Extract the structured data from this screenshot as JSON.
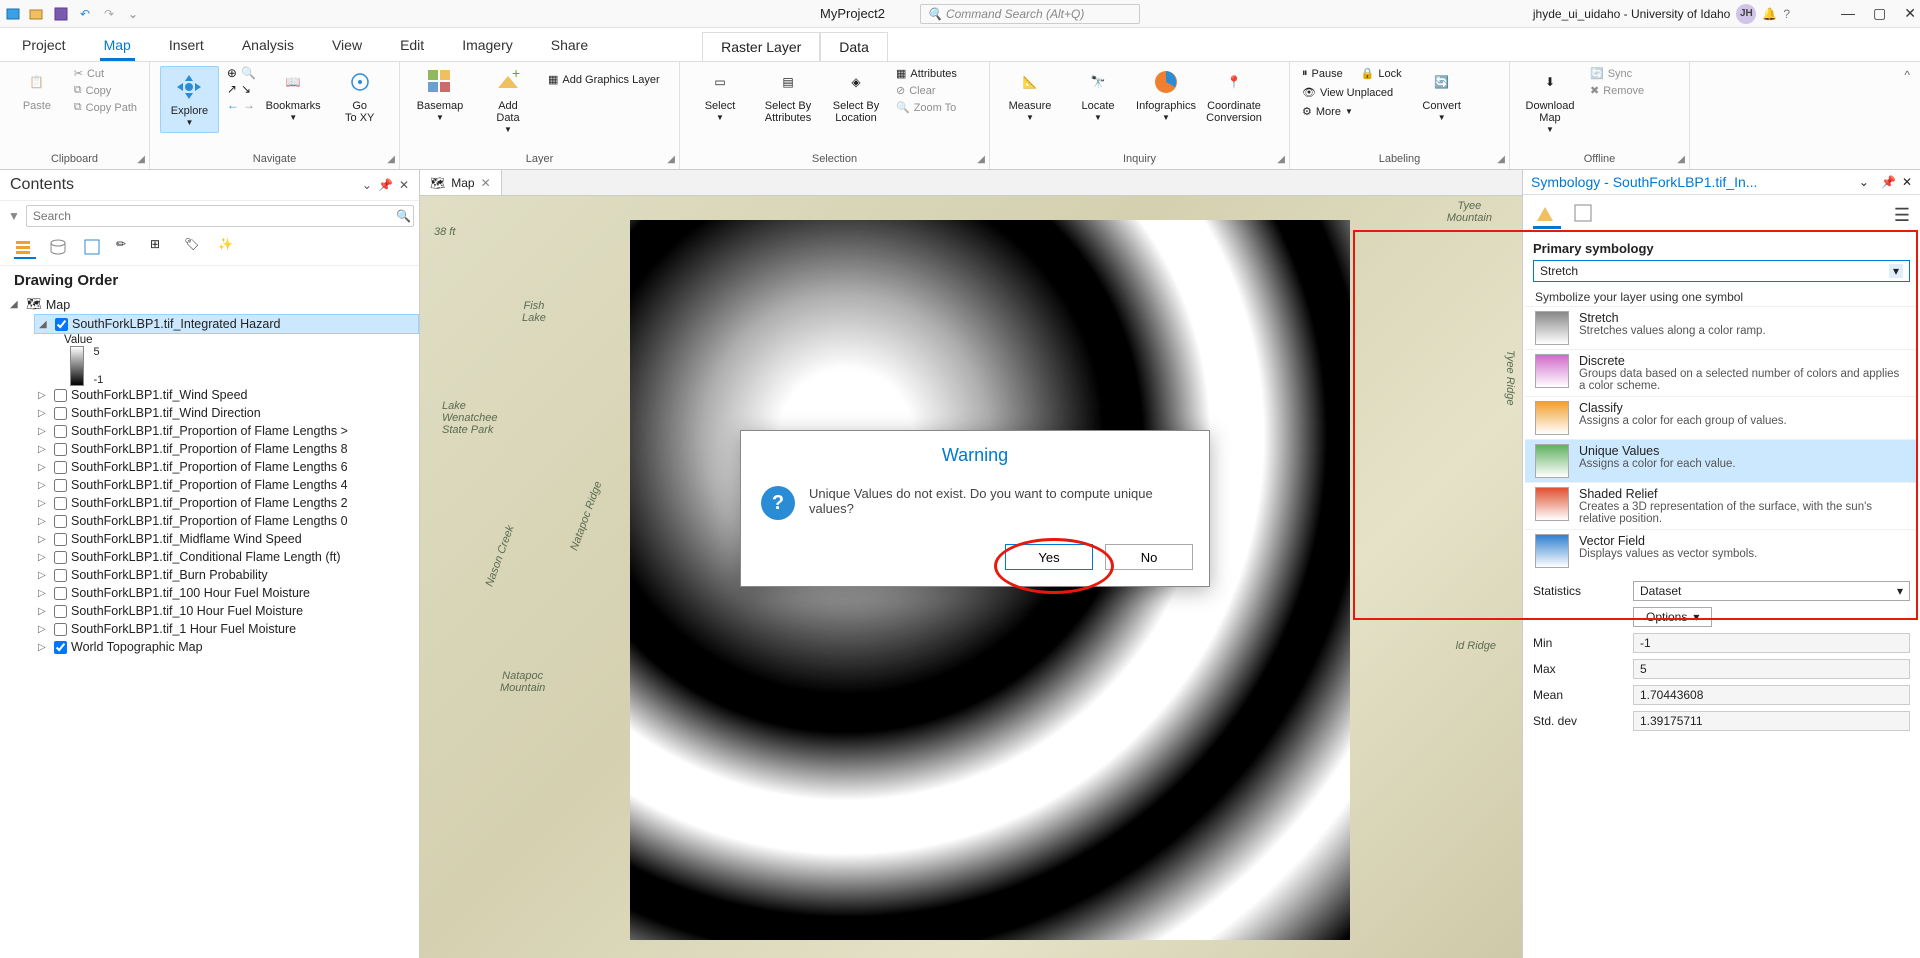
{
  "titlebar": {
    "project_name": "MyProject2",
    "search_placeholder": "Command Search (Alt+Q)",
    "user": "jhyde_ui_uidaho - University of Idaho",
    "user_initials": "JH"
  },
  "ribbon_tabs": [
    "Project",
    "Map",
    "Insert",
    "Analysis",
    "View",
    "Edit",
    "Imagery",
    "Share"
  ],
  "ribbon_active_tab": "Map",
  "context_tabs": [
    "Raster Layer",
    "Data"
  ],
  "ribbon": {
    "clipboard": {
      "label": "Clipboard",
      "paste": "Paste",
      "cut": "Cut",
      "copy": "Copy",
      "copy_path": "Copy Path"
    },
    "navigate": {
      "label": "Navigate",
      "explore": "Explore",
      "bookmarks": "Bookmarks",
      "goto_xy": "Go\nTo XY"
    },
    "layer": {
      "label": "Layer",
      "basemap": "Basemap",
      "add_data": "Add\nData",
      "add_graphics": "Add Graphics Layer"
    },
    "selection": {
      "label": "Selection",
      "select": "Select",
      "select_by_attr": "Select By\nAttributes",
      "select_by_loc": "Select By\nLocation",
      "attributes": "Attributes",
      "clear": "Clear",
      "zoom_to": "Zoom To"
    },
    "inquiry": {
      "label": "Inquiry",
      "measure": "Measure",
      "locate": "Locate",
      "infographics": "Infographics",
      "coord_conv": "Coordinate\nConversion"
    },
    "labeling": {
      "label": "Labeling",
      "pause": "Pause",
      "lock": "Lock",
      "view_unplaced": "View Unplaced",
      "more": "More",
      "convert": "Convert"
    },
    "offline": {
      "label": "Offline",
      "download_map": "Download\nMap",
      "sync": "Sync",
      "remove": "Remove"
    }
  },
  "contents": {
    "title": "Contents",
    "search_placeholder": "Search",
    "drawing_order": "Drawing Order",
    "map_name": "Map",
    "selected_layer": "SouthForkLBP1.tif_Integrated Hazard",
    "value_label": "Value",
    "legend_max": "5",
    "legend_min": "-1",
    "layers": [
      "SouthForkLBP1.tif_Wind Speed",
      "SouthForkLBP1.tif_Wind Direction",
      "SouthForkLBP1.tif_Proportion of Flame Lengths >",
      "SouthForkLBP1.tif_Proportion of Flame Lengths 8",
      "SouthForkLBP1.tif_Proportion of Flame Lengths 6",
      "SouthForkLBP1.tif_Proportion of Flame Lengths 4",
      "SouthForkLBP1.tif_Proportion of Flame Lengths 2",
      "SouthForkLBP1.tif_Proportion of Flame Lengths 0",
      "SouthForkLBP1.tif_Midflame Wind Speed",
      "SouthForkLBP1.tif_Conditional Flame Length (ft)",
      "SouthForkLBP1.tif_Burn Probability",
      "SouthForkLBP1.tif_100 Hour Fuel Moisture",
      "SouthForkLBP1.tif_10 Hour Fuel Moisture",
      "SouthForkLBP1.tif_1 Hour Fuel Moisture",
      "World Topographic Map"
    ]
  },
  "map_tab": "Map",
  "map_labels": {
    "fish_lake": "Fish\nLake",
    "wenatchee": "Lake\nWenatchee\nState Park",
    "natapoc_mtn": "Natapoc\nMountain",
    "tyee_mtn": "Tyee\nMountain",
    "tyee_ridge": "Tyee Ridge",
    "ld_ridge": "ld Ridge",
    "natapoc_ridge": "Natapoc Ridge",
    "nason_creek": "Nason Creek",
    "elev": "38 ft"
  },
  "dialog": {
    "title": "Warning",
    "message": "Unique Values do not exist. Do you want to compute unique values?",
    "yes": "Yes",
    "no": "No"
  },
  "symbology": {
    "title": "Symbology - SouthForkLBP1.tif_In...",
    "primary_label": "Primary symbology",
    "current": "Stretch",
    "dropdown_header": "Symbolize your layer using one symbol",
    "options": [
      {
        "name": "Stretch",
        "desc": "Stretches values along a color ramp."
      },
      {
        "name": "Discrete",
        "desc": "Groups data based on a selected number of colors and applies a color scheme."
      },
      {
        "name": "Classify",
        "desc": "Assigns a color for each group of values."
      },
      {
        "name": "Unique Values",
        "desc": "Assigns a color for each value."
      },
      {
        "name": "Shaded Relief",
        "desc": "Creates a 3D representation of the surface, with the sun's relative position."
      },
      {
        "name": "Vector Field",
        "desc": "Displays values as vector symbols."
      }
    ],
    "stats": {
      "statistics_label": "Statistics",
      "dataset": "Dataset",
      "options_btn": "Options",
      "min_label": "Min",
      "min": "-1",
      "max_label": "Max",
      "max": "5",
      "mean_label": "Mean",
      "mean": "1.70443608",
      "std_label": "Std. dev",
      "std": "1.39175711"
    }
  }
}
